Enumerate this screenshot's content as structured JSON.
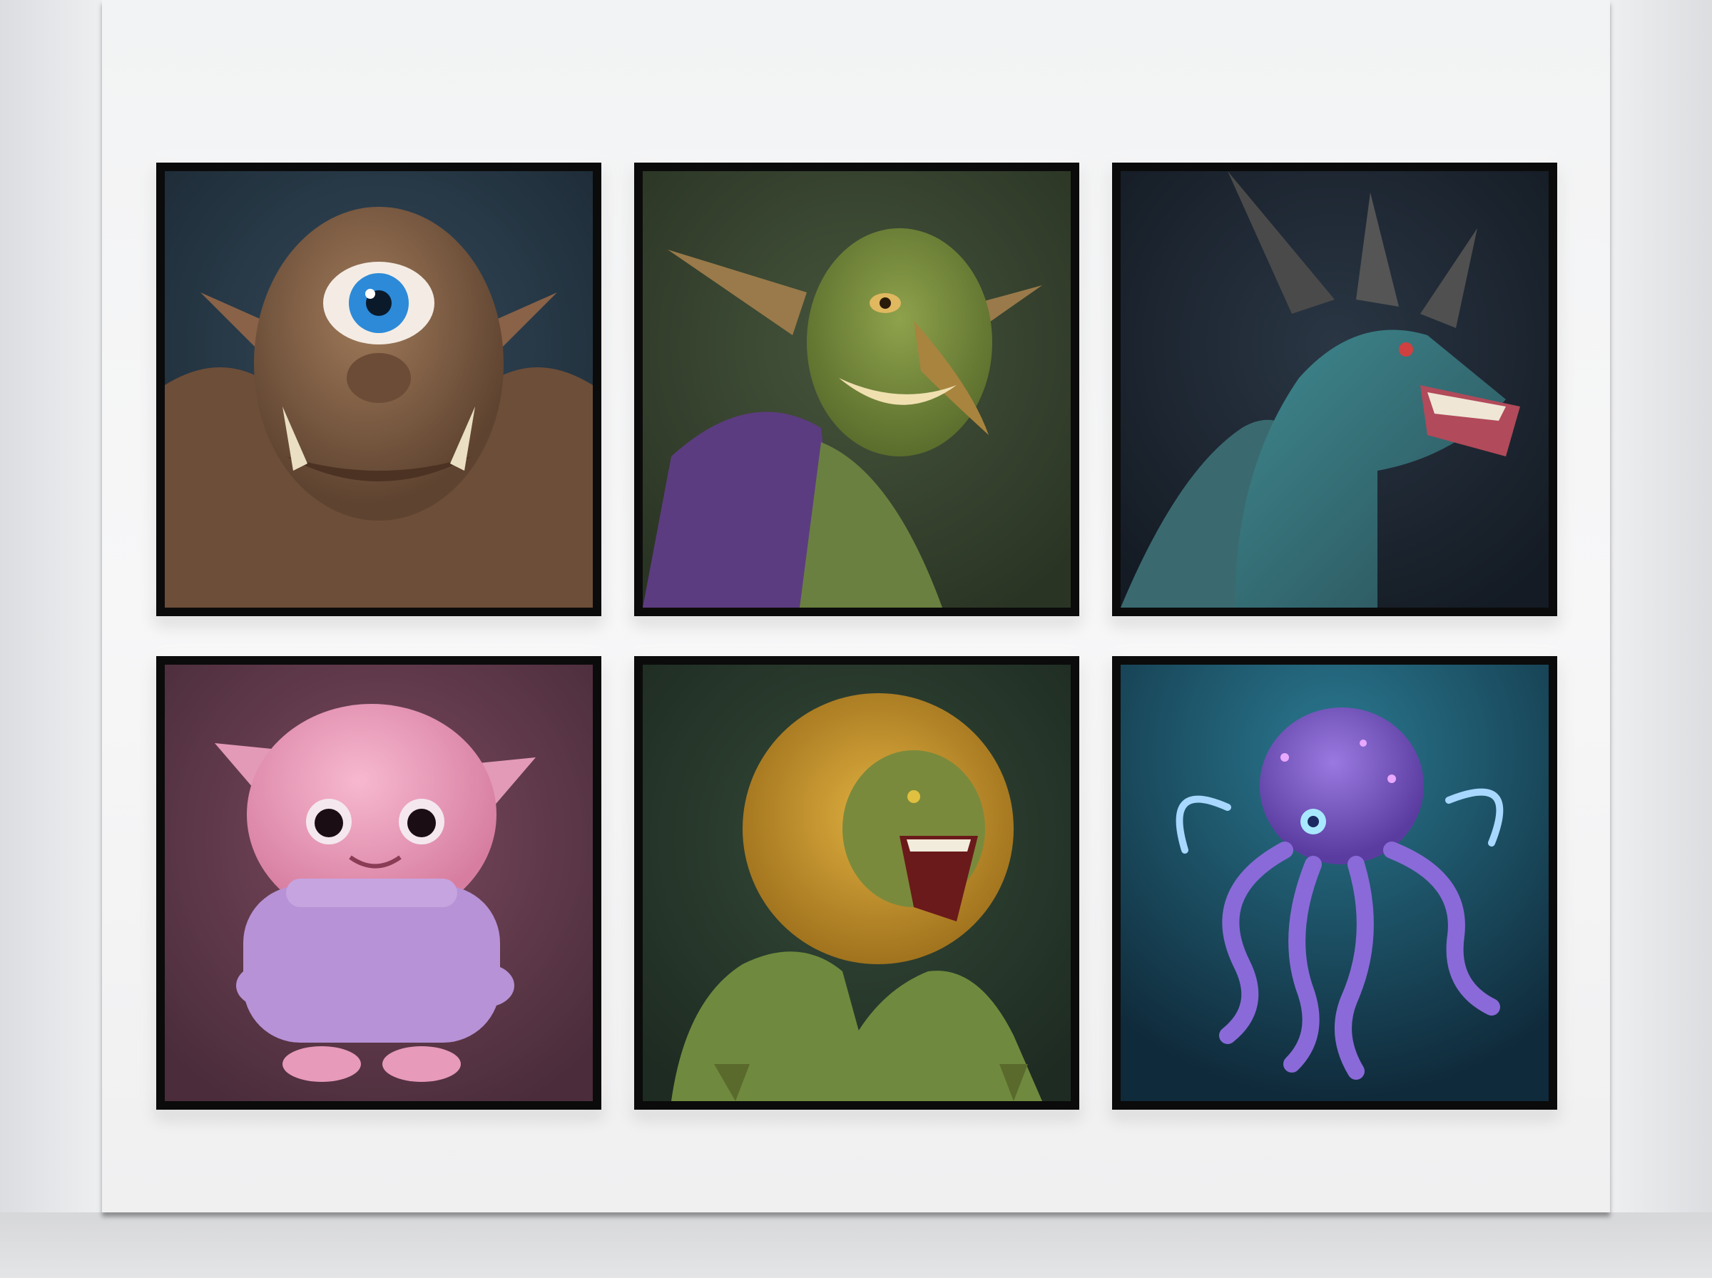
{
  "scene": {
    "wall_color": "#f4f4f5",
    "frame_color": "#0b0b0b"
  },
  "artworks": [
    {
      "subject": "cyclops",
      "background": "#24343f"
    },
    {
      "subject": "goblin",
      "background": "#33402c"
    },
    {
      "subject": "dragon",
      "background": "#1b2430"
    },
    {
      "subject": "pink-monster",
      "background": "#5a3446"
    },
    {
      "subject": "lion-beast",
      "background": "#24352a"
    },
    {
      "subject": "octopus",
      "background": "#16384a"
    }
  ]
}
